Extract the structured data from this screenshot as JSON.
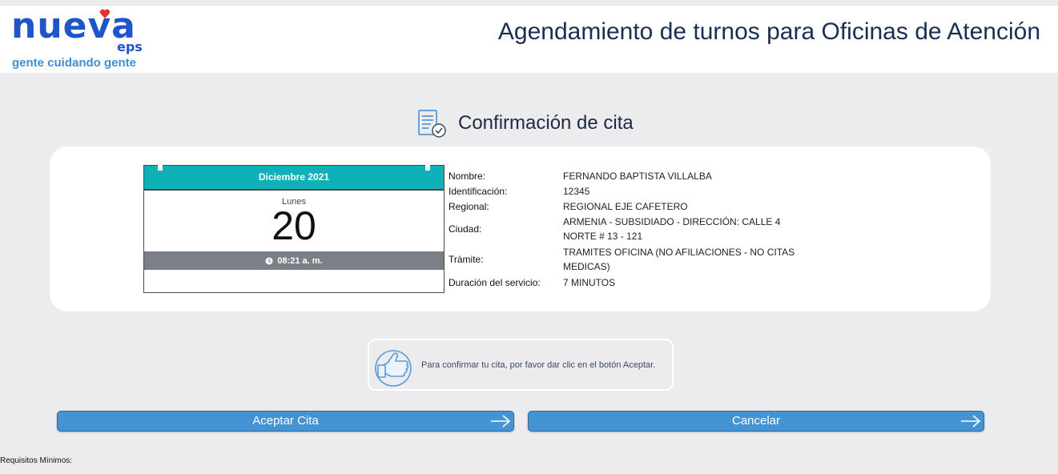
{
  "header": {
    "logo_text": "nueva",
    "logo_sub": "eps",
    "tagline": "gente cuidando gente",
    "title": "Agendamiento de turnos para Oficinas de Atención"
  },
  "section": {
    "title": "Confirmación de cita",
    "icon": "document-check-icon"
  },
  "calendar": {
    "month": "Diciembre 2021",
    "day_name": "Lunes",
    "day_number": "20",
    "time": "08:21 a. m."
  },
  "details": [
    {
      "label": "Nombre:",
      "value": "FERNANDO BAPTISTA VILLALBA"
    },
    {
      "label": "Identificación:",
      "value": "12345"
    },
    {
      "label": "Regional:",
      "value": "REGIONAL EJE CAFETERO"
    },
    {
      "label": "Ciudad:",
      "value": "ARMENIA - SUBSIDIADO - DIRECCIÓN: CALLE 4 NORTE # 13 - 121"
    },
    {
      "label": "Trámite:",
      "value": "TRAMITES OFICINA (NO AFILIACIONES - NO CITAS MEDICAS)"
    },
    {
      "label": "Duración del servicio:",
      "value": "7 MINUTOS"
    }
  ],
  "notice": {
    "text": "Para confirmar tu cita, por favor dar clic en el botón Aceptar.",
    "icon": "thumbs-up-icon"
  },
  "buttons": {
    "accept": "Aceptar Cita",
    "cancel": "Cancelar"
  },
  "footer": {
    "requirements": "Requisitos Mínimos:"
  },
  "colors": {
    "brand": "#1f55c8",
    "accent": "#e5322d",
    "teal": "#0fb1b8",
    "button": "#4493d3"
  }
}
